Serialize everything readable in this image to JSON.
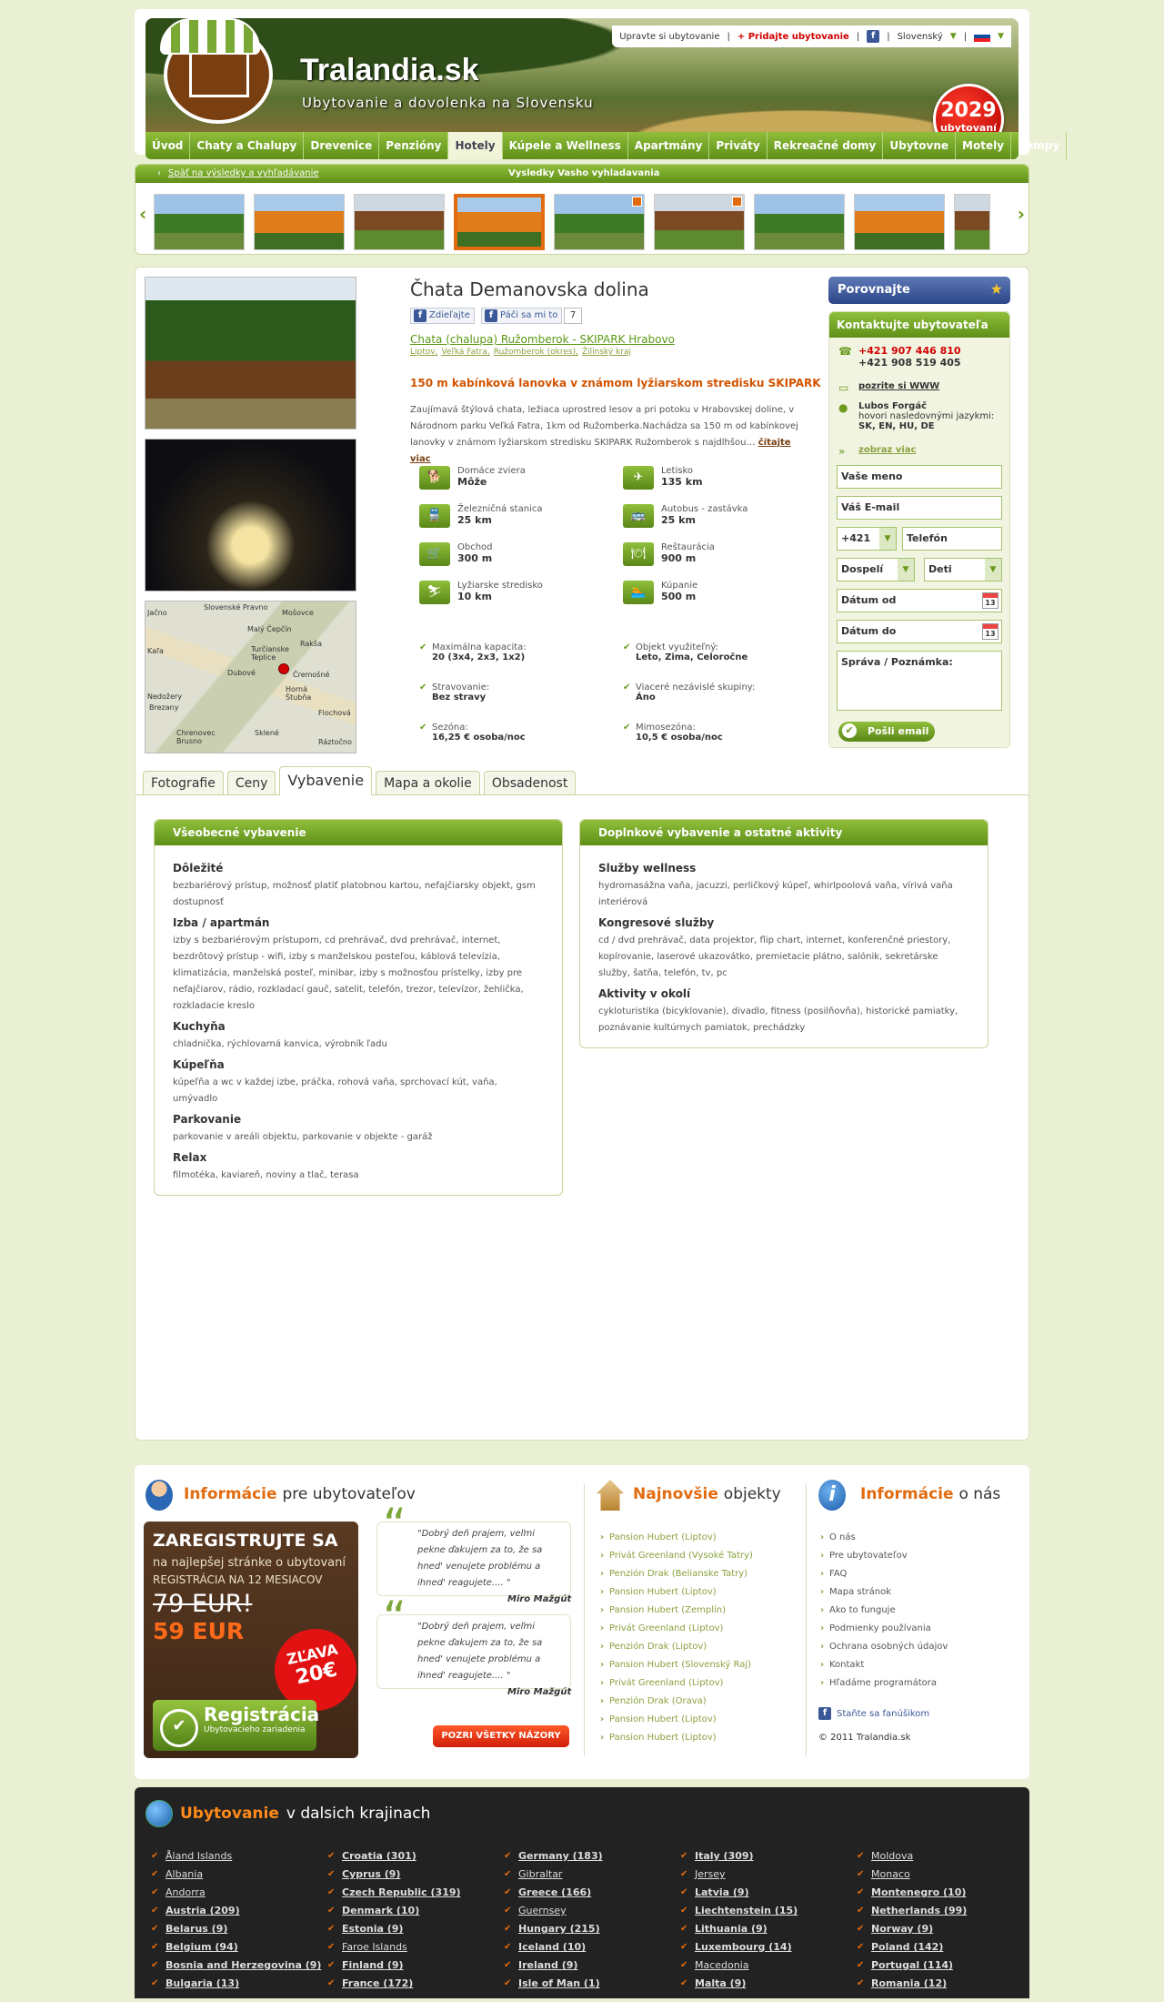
{
  "header": {
    "brand": "Tralandia.sk",
    "slogan": "Ubytovanie a dovolenka na Slovensku",
    "topbar": {
      "edit": "Upravte si ubytovanie",
      "add": "+ Pridajte ubytovanie",
      "lang": "Slovenský"
    },
    "badge_count": "2029",
    "badge_label": "ubytovaní"
  },
  "nav": [
    "Úvod",
    "Chaty a Chalupy",
    "Drevenice",
    "Penzióny",
    "Hotely",
    "Kúpele a Wellness",
    "Apartmány",
    "Priváty",
    "Rekreačné domy",
    "Ubytovne",
    "Motely",
    "Kempy"
  ],
  "gallery": {
    "back": "Späť na výsledky a vyhľadávanie",
    "title": "Vysledky Vasho vyhladavania"
  },
  "listing": {
    "title": "Čhata Demanovska dolina",
    "share": "Zdieľajte",
    "like": "Páči sa mi to",
    "like_count": "7",
    "category": "Chata (chalupa) Ružomberok - SKIPARK Hrabovo",
    "crumbs": [
      "Liptov,",
      "Veľká Fatra,",
      "Ružomberok (okres),",
      "Žilinský kraj"
    ],
    "headline": "150 m kabínková lanovka v známom lyžiarskom stredisku SKIPARK",
    "description": "Zaujímavá štýlová chata, ležiaca uprostred lesov a pri potoku v Hrabovskej doline, v Národnom parku Veľká Fatra, 1km od Ružomberka.Nachádza sa 150 m od kabínkovej lanovky v známom lyžiarskom stredisku SKIPARK Ružomberok s najdlhšou…",
    "more": "čítajte viac",
    "map_labels": [
      "Slovenské Pravno",
      "Mošovce",
      "Jačno",
      "Malý Čepčín",
      "Rakša",
      "Turčianske Teplice",
      "Kaľa",
      "Dubové",
      "Čremošné",
      "Horná Štubňa",
      "Nedožery",
      "Brezany",
      "Flochová",
      "Chrenovec Brusno",
      "Sklené",
      "Ráztočno",
      "Sklené"
    ],
    "amenities": [
      {
        "label": "Domáce zviera",
        "value": "Môže",
        "icon": "dog-icon",
        "glyph": "🐕"
      },
      {
        "label": "Letisko",
        "value": "135 km",
        "icon": "plane-icon",
        "glyph": "✈"
      },
      {
        "label": "Železničná stanica",
        "value": "25 km",
        "icon": "train-icon",
        "glyph": "🚆"
      },
      {
        "label": "Autobus - zastávka",
        "value": "25 km",
        "icon": "bus-icon",
        "glyph": "🚌"
      },
      {
        "label": "Obchod",
        "value": "300 m",
        "icon": "cart-icon",
        "glyph": "🛒"
      },
      {
        "label": "Reštaurácia",
        "value": "900 m",
        "icon": "plate-icon",
        "glyph": "🍽"
      },
      {
        "label": "Lyžiarske stredisko",
        "value": "10 km",
        "icon": "ski-icon",
        "glyph": "⛷"
      },
      {
        "label": "Kúpanie",
        "value": "500 m",
        "icon": "swim-icon",
        "glyph": "🏊"
      }
    ],
    "info": [
      {
        "label": "Maximálna kapacita:",
        "value": "20 (3x4, 2x3, 1x2)"
      },
      {
        "label": "Objekt využiteľný:",
        "value": "Leto, Zima, Celoročne"
      },
      {
        "label": "Stravovanie:",
        "value": "Bez stravy"
      },
      {
        "label": "Viaceré nezávislé skupiny:",
        "value": "Áno"
      },
      {
        "label": "Sezóna:",
        "value": "16,25 € osoba/noc"
      },
      {
        "label": "Mimosezóna:",
        "value": "10,5 € osoba/noc"
      }
    ]
  },
  "contact": {
    "compare": "Porovnajte",
    "header": "Kontaktujte ubytovateľa",
    "phone1": "+421 907 446 810",
    "phone2": "+421 908 519 405",
    "www": "pozrite si WWW",
    "person": "Lubos Forgáč",
    "lang_label": "hovori nasledovnými jazykmi:",
    "langs": "SK, EN, HU, DE",
    "map_link": "zobraz viac",
    "name_ph": "Vaše meno",
    "email_ph": "Váš E-mail",
    "prefix": "+421",
    "phone_ph": "Telefón",
    "adults": "Dospelí",
    "kids": "Deti",
    "date_from": "Dátum od",
    "date_to": "Dátum do",
    "message_ph": "Správa / Poznámka:",
    "send": "Pošli email"
  },
  "tabs": [
    "Fotografie",
    "Ceny",
    "Vybavenie",
    "Mapa a okolie",
    "Obsadenost"
  ],
  "equipment": {
    "left_title": "Všeobecné vybavenie",
    "left": [
      {
        "h": "Dôležité",
        "t": "bezbariérový prístup, možnosť platiť platobnou kartou, nefajčiarsky objekt, gsm dostupnosť"
      },
      {
        "h": "Izba / apartmán",
        "t": "izby s bezbariérovým prístupom, cd prehrávač, dvd prehrávač, internet, bezdrôtový prístup - wifi, izby s manželskou posteľou, káblová televízia, klimatizácia, manželská posteľ, minibar, izby s možnosťou prístelky, izby pre nefajčiarov, rádio, rozkladací gauč, satelit, telefón, trezor, televízor, žehlička, rozkladacie kreslo"
      },
      {
        "h": "Kuchyňa",
        "t": "chladnička, rýchlovarná kanvica, výrobník ľadu"
      },
      {
        "h": "Kúpeľňa",
        "t": "kúpeľňa a wc v každej izbe, práčka, rohová vaňa, sprchovací kút, vaňa, umývadlo"
      },
      {
        "h": "Parkovanie",
        "t": "parkovanie v areáli objektu, parkovanie v objekte - garáž"
      },
      {
        "h": "Relax",
        "t": "filmotéka, kaviareň, noviny a tlač, terasa"
      }
    ],
    "right_title": "Doplnkové vybavenie a ostatné aktivity",
    "right": [
      {
        "h": "Služby wellness",
        "t": "hydromasážna vaňa, jacuzzi, perličkový kúpeľ, whirlpoolová vaňa, vírivá vaňa interiérová"
      },
      {
        "h": "Kongresové služby",
        "t": "cd / dvd prehrávač, data projektor, flip chart, internet, konferenčné priestory, kopírovanie, laserové ukazovátko, premietacie plátno, salónik, sekretárske služby, šatňa, telefón, tv, pc"
      },
      {
        "h": "Aktivity v okolí",
        "t": "cykloturistika (bicyklovanie), divadlo, fitness (posilňovňa), historické pamiatky, poznávanie kultúrnych pamiatok, prechádzky"
      }
    ]
  },
  "footer": {
    "col1_a": "Informácie",
    "col1_b": "pre ubytovateľov",
    "reg": {
      "t1": "ZAREGISTRUJTE SA",
      "t2": "na najlepšej stránke o ubytovaní",
      "t3": "REGISTRÁCIA NA 12 MESIACOV",
      "old": "79 EUR!",
      "new": "59 EUR",
      "zl_a": "ZĽAVA",
      "zl_b": "20€",
      "btn": "Registrácia",
      "btn_sub": "Ubytovacieho zariadenia"
    },
    "quotes": [
      {
        "t": "\"Dobrý deň prajem, veľmi pekne ďakujem za to, že sa hned' venujete problému a ihned' reagujete.... \"",
        "a": "Miro Mažgút"
      },
      {
        "t": "\"Dobrý deň prajem, veľmi pekne ďakujem za to, že sa hned' venujete problému a ihned' reagujete.... \"",
        "a": "Miro Mažgút"
      }
    ],
    "all_reviews": "POZRI VŠETKY NÁZORY",
    "col2_a": "Najnovšie",
    "col2_b": "objekty",
    "newest": [
      "Pansion Hubert (Liptov)",
      "Privát Greenland (Vysoké Tatry)",
      "Penzión Drak (Belianske Tatry)",
      "Pansion Hubert (Liptov)",
      "Pansion Hubert (Zemplín)",
      "Privát Greenland (Liptov)",
      "Penzión Drak (Liptov)",
      "Pansion Hubert (Slovenský Raj)",
      "Privát Greenland (Liptov)",
      "Penzión Drak (Orava)",
      "Pansion Hubert (Liptov)",
      "Pansion Hubert (Liptov)"
    ],
    "col3_a": "Informácie",
    "col3_b": "o nás",
    "about": [
      "O nás",
      "Pre ubytovateľov",
      "FAQ",
      "Mapa stránok",
      "Ako to funguje",
      "Podmienky používania",
      "Ochrana osobných údajov",
      "Kontakt",
      "Hľadáme programátora"
    ],
    "fan": "Staňte sa fanúšikom",
    "copy": "© 2011 Tralandia.sk"
  },
  "countries": {
    "title_a": "Ubytovanie",
    "title_b": "v dalsich krajinach",
    "cols": [
      [
        {
          "n": "Åland Islands",
          "b": false
        },
        {
          "n": "Albania",
          "b": false
        },
        {
          "n": "Andorra",
          "b": false
        },
        {
          "n": "Austria (209)",
          "b": true
        },
        {
          "n": "Belarus (9)",
          "b": true
        },
        {
          "n": "Belgium (94)",
          "b": true
        },
        {
          "n": "Bosnia and Herzegovina (9)",
          "b": true
        },
        {
          "n": "Bulgaria (13)",
          "b": true
        }
      ],
      [
        {
          "n": "Croatia (301)",
          "b": true
        },
        {
          "n": "Cyprus (9)",
          "b": true
        },
        {
          "n": "Czech Republic (319)",
          "b": true
        },
        {
          "n": "Denmark (10)",
          "b": true
        },
        {
          "n": "Estonia (9)",
          "b": true
        },
        {
          "n": "Faroe Islands",
          "b": false
        },
        {
          "n": "Finland (9)",
          "b": true
        },
        {
          "n": "France (172)",
          "b": true
        }
      ],
      [
        {
          "n": "Germany (183)",
          "b": true
        },
        {
          "n": "Gibraltar",
          "b": false
        },
        {
          "n": "Greece (166)",
          "b": true
        },
        {
          "n": "Guernsey",
          "b": false
        },
        {
          "n": "Hungary (215)",
          "b": true
        },
        {
          "n": "Iceland (10)",
          "b": true
        },
        {
          "n": "Ireland (9)",
          "b": true
        },
        {
          "n": "Isle of Man (1)",
          "b": true
        }
      ],
      [
        {
          "n": "Italy (309)",
          "b": true
        },
        {
          "n": "Jersey",
          "b": false
        },
        {
          "n": "Latvia (9)",
          "b": true
        },
        {
          "n": "Liechtenstein (15)",
          "b": true
        },
        {
          "n": "Lithuania (9)",
          "b": true
        },
        {
          "n": "Luxembourg (14)",
          "b": true
        },
        {
          "n": "Macedonia",
          "b": false
        },
        {
          "n": "Malta (9)",
          "b": true
        }
      ],
      [
        {
          "n": "Moldova",
          "b": false
        },
        {
          "n": "Monaco",
          "b": false
        },
        {
          "n": "Montenegro (10)",
          "b": true
        },
        {
          "n": "Netherlands (99)",
          "b": true
        },
        {
          "n": "Norway (9)",
          "b": true
        },
        {
          "n": "Poland (142)",
          "b": true
        },
        {
          "n": "Portugal (114)",
          "b": true
        },
        {
          "n": "Romania (12)",
          "b": true
        }
      ]
    ]
  }
}
